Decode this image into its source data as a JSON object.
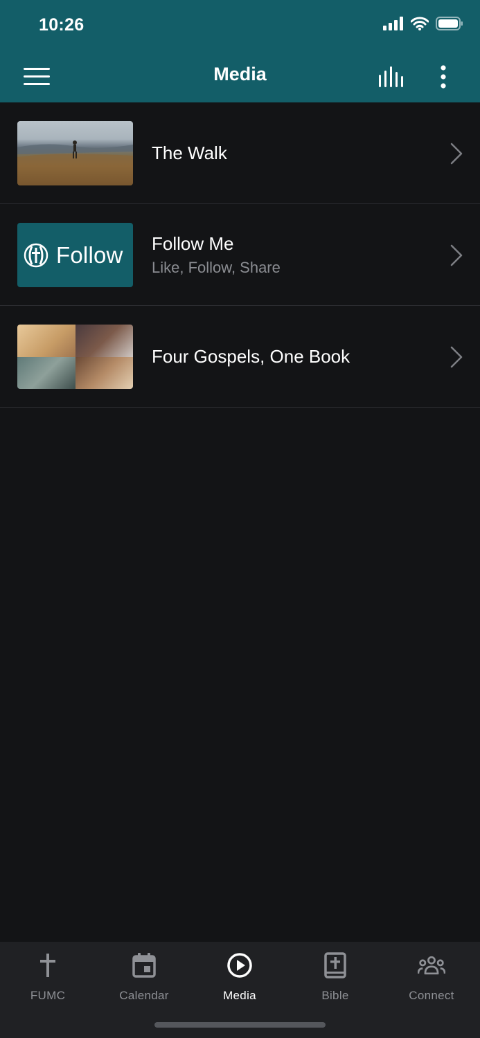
{
  "status_bar": {
    "time": "10:26"
  },
  "toolbar": {
    "title": "Media"
  },
  "media_items": [
    {
      "title": "The Walk",
      "subtitle": ""
    },
    {
      "title": "Follow Me",
      "subtitle": "Like, Follow, Share",
      "thumb_text": "Follow"
    },
    {
      "title": "Four Gospels, One Book",
      "subtitle": ""
    }
  ],
  "tabs": [
    {
      "label": "FUMC",
      "icon": "cross-icon",
      "active": false
    },
    {
      "label": "Calendar",
      "icon": "calendar-icon",
      "active": false
    },
    {
      "label": "Media",
      "icon": "play-circle-icon",
      "active": true
    },
    {
      "label": "Bible",
      "icon": "bible-icon",
      "active": false
    },
    {
      "label": "Connect",
      "icon": "people-icon",
      "active": false
    }
  ],
  "colors": {
    "header": "#135e68",
    "background": "#131416",
    "tabbar": "#202124",
    "inactive_tab": "#8f9196",
    "subtitle": "#8b8d92"
  }
}
